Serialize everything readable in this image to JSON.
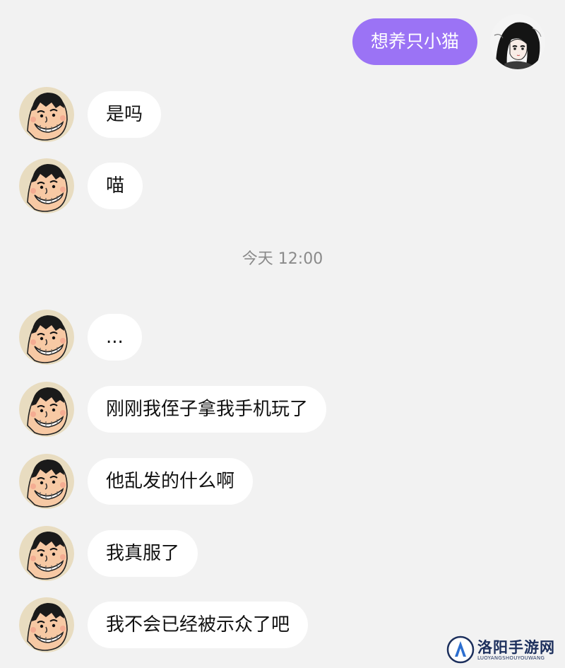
{
  "chat": {
    "outgoing_message": "想养只小猫",
    "incoming_messages": [
      "是吗",
      "喵",
      "...",
      "刚刚我侄子拿我手机玩了",
      "他乱发的什么啊",
      "我真服了",
      "我不会已经被示众了吧"
    ],
    "timestamp": "今天 12:00"
  },
  "avatars": {
    "self": "anime-girl-avatar",
    "contact": "cartoon-grinning-man-avatar"
  },
  "watermark": {
    "title": "洛阳手游网",
    "subtitle": "LUOYANGSHOUYOUWANG"
  },
  "colors": {
    "background": "#f2f2f2",
    "outgoing_bubble": "#9b73f5",
    "incoming_bubble": "#ffffff",
    "timestamp_text": "#8a8a8a"
  }
}
